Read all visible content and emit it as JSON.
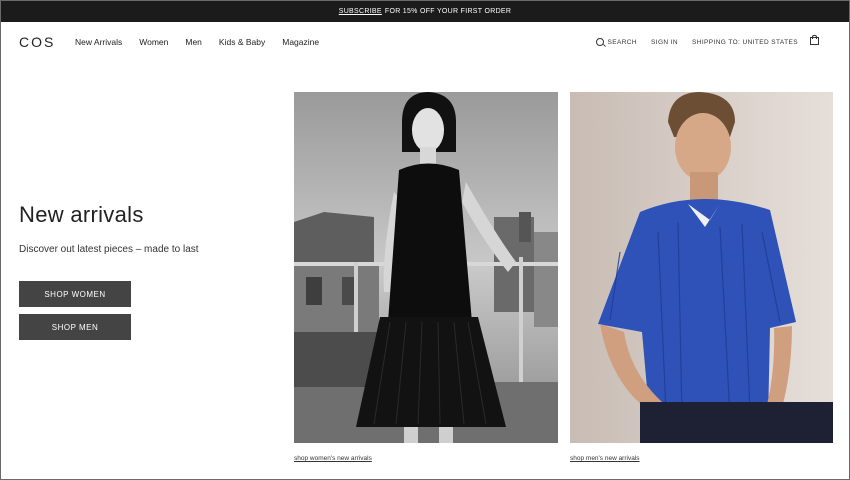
{
  "promo": {
    "link": "SUBSCRIBE",
    "text": "FOR 15% OFF YOUR FIRST ORDER"
  },
  "header": {
    "logo": "COS",
    "menu": [
      "New Arrivals",
      "Women",
      "Men",
      "Kids & Baby",
      "Magazine"
    ],
    "search": "SEARCH",
    "sign_in": "SIGN IN",
    "shipping": "SHIPPING TO: UNITED STATES"
  },
  "hero": {
    "title": "New arrivals",
    "subtitle": "Discover out latest pieces – made to last",
    "shop_women": "SHOP WOMEN",
    "shop_men": "SHOP MEN"
  },
  "images": {
    "women_caption": "shop women's new arrivals",
    "men_caption": "shop men's new arrivals"
  },
  "colors": {
    "shirt_blue": "#2e52b8",
    "dark_button": "#444444"
  }
}
